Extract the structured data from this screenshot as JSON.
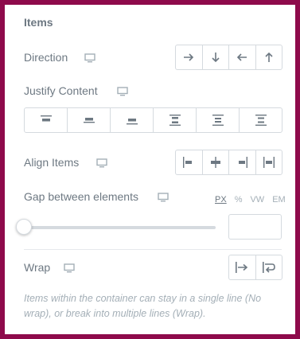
{
  "section": {
    "title": "Items"
  },
  "direction": {
    "label": "Direction",
    "buttons": [
      "arrow-right-icon",
      "arrow-down-icon",
      "arrow-left-icon",
      "arrow-up-icon"
    ]
  },
  "justify": {
    "label": "Justify Content",
    "buttons": [
      "justify-start-icon",
      "justify-center-icon",
      "justify-end-icon",
      "justify-space-between-icon",
      "justify-space-around-icon",
      "justify-space-evenly-icon"
    ]
  },
  "align": {
    "label": "Align Items",
    "buttons": [
      "align-start-icon",
      "align-center-icon",
      "align-end-icon",
      "align-stretch-icon"
    ]
  },
  "gap": {
    "label": "Gap between elements",
    "units": [
      "PX",
      "%",
      "VW",
      "EM"
    ],
    "active_unit": "PX",
    "slider_value": 0,
    "input_value": ""
  },
  "wrap": {
    "label": "Wrap",
    "buttons": [
      "no-wrap-icon",
      "wrap-icon"
    ]
  },
  "help": {
    "text": "Items within the container can stay in a single line (No wrap), or break into multiple lines (Wrap)."
  },
  "colors": {
    "frame": "#8e0a4b",
    "text": "#6d7882",
    "muted": "#a4afb7",
    "border": "#d5dadf"
  }
}
